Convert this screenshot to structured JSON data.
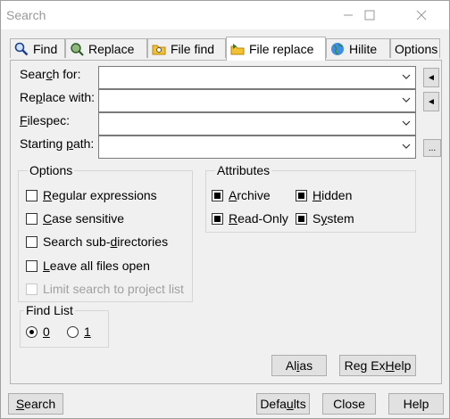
{
  "window": {
    "title": "Search"
  },
  "tabs": [
    {
      "label": "Find",
      "icon": "magnifier-icon"
    },
    {
      "label": "Replace",
      "icon": "replace-icon"
    },
    {
      "label": "File find",
      "icon": "folder-search-icon"
    },
    {
      "label": "File replace",
      "icon": "folder-replace-icon",
      "active": true
    },
    {
      "label": "Hilite",
      "icon": "globe-icon"
    },
    {
      "label": "Options",
      "icon": ""
    }
  ],
  "fields": {
    "search_for": {
      "label_pre": "Sear",
      "label_key": "c",
      "label_post": "h for:",
      "value": ""
    },
    "replace_with": {
      "label_pre": "Re",
      "label_key": "p",
      "label_post": "lace with:",
      "value": ""
    },
    "filespec": {
      "label_pre": "",
      "label_key": "F",
      "label_post": "ilespec:",
      "value": ""
    },
    "starting_path": {
      "label_pre": "Starting ",
      "label_key": "p",
      "label_post": "ath:",
      "value": ""
    }
  },
  "side_buttons": {
    "arrow": "◄",
    "browse": "..."
  },
  "options": {
    "title": "Options",
    "items": [
      {
        "pre": "",
        "key": "R",
        "post": "egular expressions",
        "checked": false,
        "disabled": false
      },
      {
        "pre": "",
        "key": "C",
        "post": "ase sensitive",
        "checked": false,
        "disabled": false
      },
      {
        "pre": "Search sub-",
        "key": "d",
        "post": "irectories",
        "checked": false,
        "disabled": false
      },
      {
        "pre": "",
        "key": "L",
        "post": "eave all files open",
        "checked": false,
        "disabled": false
      },
      {
        "pre": "Limit search to project list",
        "key": "",
        "post": "",
        "checked": false,
        "disabled": true
      }
    ]
  },
  "attributes": {
    "title": "Attributes",
    "items": [
      {
        "pre": "",
        "key": "A",
        "post": "rchive",
        "checked": true
      },
      {
        "pre": "",
        "key": "H",
        "post": "idden",
        "checked": true
      },
      {
        "pre": "",
        "key": "R",
        "post": "ead-Only",
        "checked": true
      },
      {
        "pre": "S",
        "key": "y",
        "post": "stem",
        "checked": true
      }
    ]
  },
  "find_list": {
    "title": "Find List",
    "options": [
      {
        "label": "0",
        "selected": true
      },
      {
        "label": "1",
        "selected": false
      }
    ]
  },
  "buttons": {
    "alias": {
      "pre": "Al",
      "key": "i",
      "post": "as"
    },
    "regex_help": {
      "pre": "Reg Ex ",
      "key": "H",
      "post": "elp"
    },
    "search": {
      "pre": "",
      "key": "S",
      "post": "earch"
    },
    "defaults": {
      "pre": "Defa",
      "key": "u",
      "post": "lts"
    },
    "close": {
      "pre": "Close",
      "key": "",
      "post": ""
    },
    "help": {
      "pre": "Help",
      "key": "",
      "post": ""
    }
  },
  "colors": {
    "accent": "#000000",
    "disabled_text": "#a0a0a0"
  }
}
